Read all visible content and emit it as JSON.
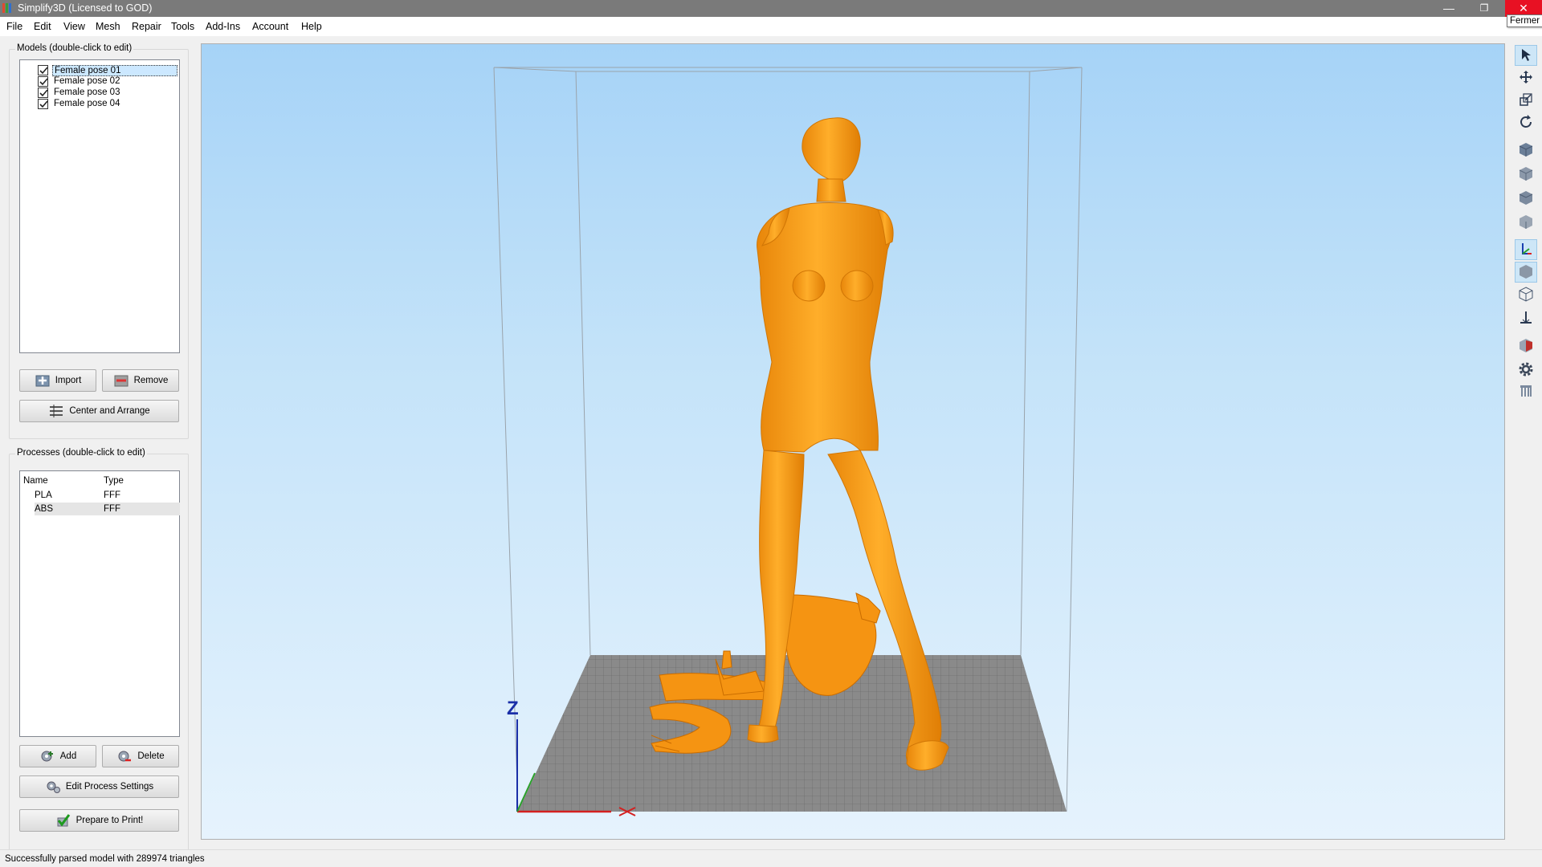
{
  "window": {
    "title": "Simplify3D (Licensed to GOD)",
    "minimize_glyph": "—",
    "restore_glyph": "❐",
    "close_glyph": "✕",
    "close_tooltip": "Fermer"
  },
  "menu": [
    "File",
    "Edit",
    "View",
    "Mesh",
    "Repair",
    "Tools",
    "Add-Ins",
    "Account",
    "Help"
  ],
  "models": {
    "group_title": "Models (double-click to edit)",
    "items": [
      {
        "label": "Female pose 01",
        "checked": true,
        "selected": true
      },
      {
        "label": "Female pose 02",
        "checked": true,
        "selected": false
      },
      {
        "label": "Female pose 03",
        "checked": true,
        "selected": false
      },
      {
        "label": "Female pose 04",
        "checked": true,
        "selected": false
      }
    ],
    "import_label": "Import",
    "remove_label": "Remove",
    "center_arrange_label": "Center and Arrange"
  },
  "processes": {
    "group_title": "Processes (double-click to edit)",
    "col_name": "Name",
    "col_type": "Type",
    "rows": [
      {
        "name": "PLA",
        "type": "FFF"
      },
      {
        "name": "ABS",
        "type": "FFF"
      }
    ],
    "add_label": "Add",
    "delete_label": "Delete",
    "edit_settings_label": "Edit Process Settings",
    "prepare_label": "Prepare to Print!"
  },
  "viewport": {
    "axis_z_label": "Z",
    "model_color": "#ff9e1b",
    "bed_color": "#8a8a8a",
    "grid_color": "#6e6e6e"
  },
  "toolbar": [
    {
      "name": "select-icon",
      "active": true
    },
    {
      "name": "move-icon",
      "active": false
    },
    {
      "name": "scale-icon",
      "active": false
    },
    {
      "name": "rotate-icon",
      "active": false
    },
    {
      "name": "view-iso-icon",
      "active": false
    },
    {
      "name": "view-front-icon",
      "active": false
    },
    {
      "name": "view-top-icon",
      "active": false
    },
    {
      "name": "view-side-icon",
      "active": false
    },
    {
      "name": "axes-icon",
      "active": true
    },
    {
      "name": "solid-view-icon",
      "active": true
    },
    {
      "name": "wireframe-view-icon",
      "active": false
    },
    {
      "name": "cross-section-icon",
      "active": false
    },
    {
      "name": "section-view-icon",
      "active": false
    },
    {
      "name": "settings-gear-icon",
      "active": false
    },
    {
      "name": "supports-icon",
      "active": false
    }
  ],
  "status": {
    "text": "Successfully parsed model with 289974 triangles"
  }
}
